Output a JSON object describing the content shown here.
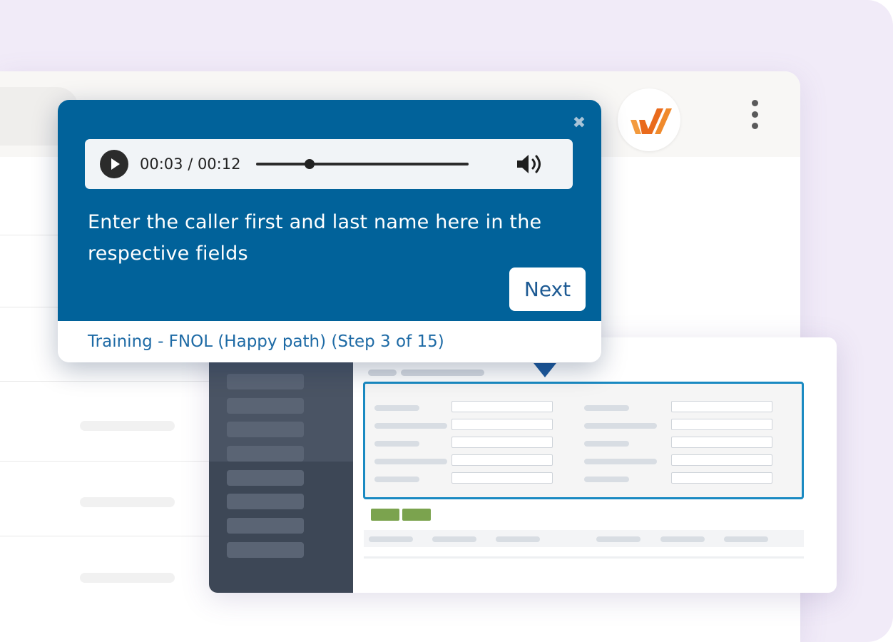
{
  "walkthrough": {
    "close_icon": "close-icon",
    "audio": {
      "current_time": "00:03",
      "duration": "00:12",
      "time_text": "00:03 / 00:12",
      "progress_fraction": 0.25,
      "play_icon": "play-icon",
      "volume_icon": "volume-icon"
    },
    "message": "Enter the caller first and last name here in the respective fields",
    "next_label": "Next",
    "footer": "Training - FNOL (Happy path) (Step 3 of 15)"
  },
  "browser": {
    "extension_icon": "walkme-logo-icon",
    "menu_icon": "kebab-menu-icon"
  },
  "colors": {
    "popup_bg": "#01629a",
    "highlight_border": "#1a8ac2",
    "action_green": "#7ba34e",
    "background": "#f1ebf8"
  }
}
